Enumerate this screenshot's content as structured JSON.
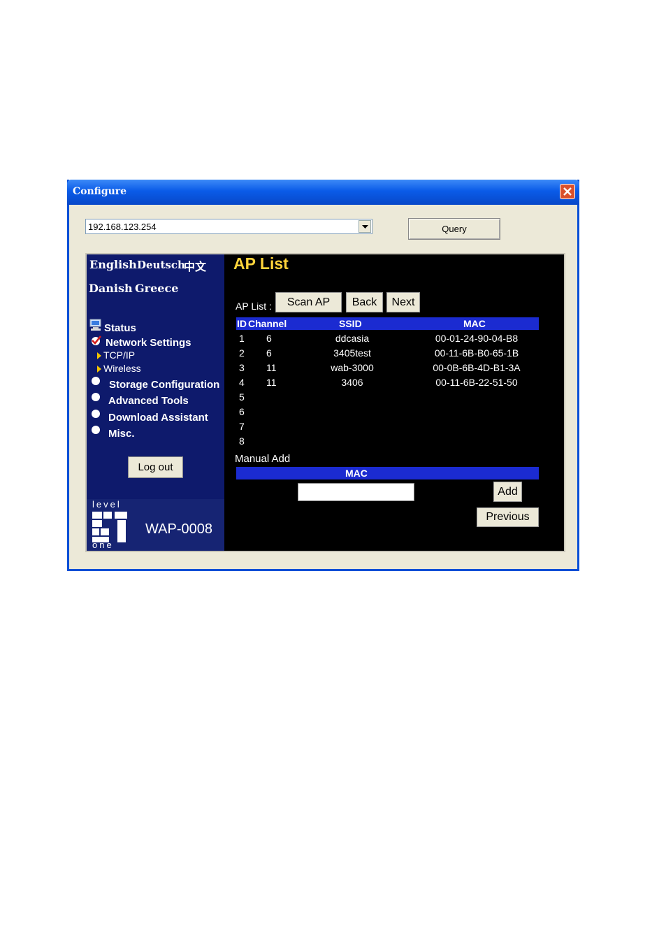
{
  "window": {
    "title": "Configure"
  },
  "address": {
    "value": "192.168.123.254",
    "query_label": "Query"
  },
  "languages": {
    "english": "English",
    "deutsch": "Deutsch",
    "chinese": "中文",
    "danish": "Danish",
    "greece": "Greece"
  },
  "sidebar": {
    "status": "Status",
    "network_settings": "Network Settings",
    "tcpip": "TCP/IP",
    "wireless": "Wireless",
    "storage": "Storage Configuration",
    "advanced": "Advanced Tools",
    "download": "Download Assistant",
    "misc": "Misc.",
    "logout": "Log out"
  },
  "logo": {
    "top": "level",
    "bottom": "one",
    "model": "WAP-0008"
  },
  "main": {
    "title": "AP List",
    "ap_list_label": "AP List :",
    "scan_label": "Scan AP",
    "back_label": "Back",
    "next_label": "Next",
    "headers": {
      "id": "ID",
      "channel": "Channel",
      "ssid": "SSID",
      "mac": "MAC"
    },
    "rows": [
      {
        "id": "1",
        "channel": "6",
        "ssid": "ddcasia",
        "mac": "00-01-24-90-04-B8"
      },
      {
        "id": "2",
        "channel": "6",
        "ssid": "3405test",
        "mac": "00-11-6B-B0-65-1B"
      },
      {
        "id": "3",
        "channel": "11",
        "ssid": "wab-3000",
        "mac": "00-0B-6B-4D-B1-3A"
      },
      {
        "id": "4",
        "channel": "11",
        "ssid": "3406",
        "mac": "00-11-6B-22-51-50"
      },
      {
        "id": "5",
        "channel": "",
        "ssid": "",
        "mac": ""
      },
      {
        "id": "6",
        "channel": "",
        "ssid": "",
        "mac": ""
      },
      {
        "id": "7",
        "channel": "",
        "ssid": "",
        "mac": ""
      },
      {
        "id": "8",
        "channel": "",
        "ssid": "",
        "mac": ""
      }
    ],
    "manual_add_label": "Manual Add",
    "mac_header": "MAC",
    "add_label": "Add",
    "previous_label": "Previous"
  }
}
